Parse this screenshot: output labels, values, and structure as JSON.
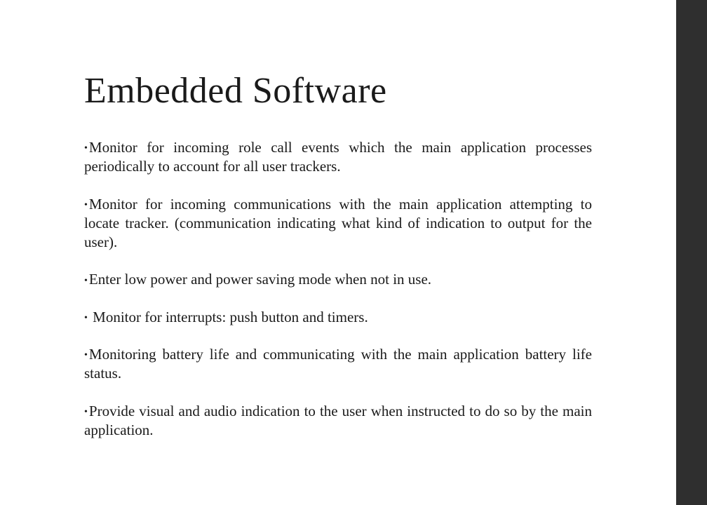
{
  "slide": {
    "title": "Embedded Software",
    "bullets": [
      "Monitor for incoming role call events which the main application processes periodically to account for all user trackers.",
      "Monitor for incoming communications with the main application attempting to locate tracker. (communication indicating what kind of indication to output for the user).",
      "Enter low power and power saving mode when not in use.",
      " Monitor for interrupts: push button and timers.",
      "Monitoring battery life and communicating with the main application battery life status.",
      "Provide visual and audio indication to the user when instructed to do so by the main application."
    ]
  }
}
